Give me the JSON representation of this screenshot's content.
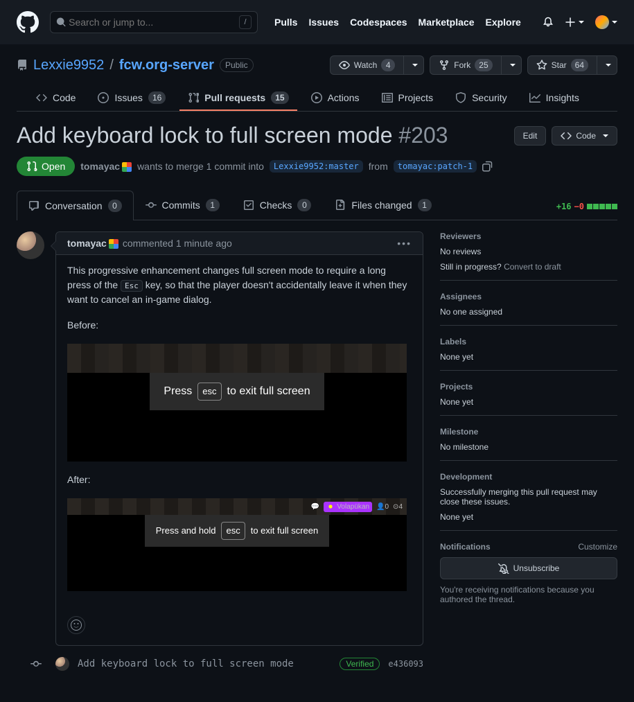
{
  "header": {
    "search_placeholder": "Search or jump to...",
    "slash": "/",
    "nav": {
      "pulls": "Pulls",
      "issues": "Issues",
      "codespaces": "Codespaces",
      "marketplace": "Marketplace",
      "explore": "Explore"
    }
  },
  "repo": {
    "owner": "Lexxie9952",
    "name": "fcw.org-server",
    "visibility": "Public",
    "watch_label": "Watch",
    "watch_count": "4",
    "fork_label": "Fork",
    "fork_count": "25",
    "star_label": "Star",
    "star_count": "64"
  },
  "repo_tabs": {
    "code": "Code",
    "issues": "Issues",
    "issues_count": "16",
    "pulls": "Pull requests",
    "pulls_count": "15",
    "actions": "Actions",
    "projects": "Projects",
    "security": "Security",
    "insights": "Insights"
  },
  "pr": {
    "title": "Add keyboard lock to full screen mode",
    "number": "#203",
    "edit": "Edit",
    "code_btn": "Code",
    "state": "Open",
    "author": "tomayac",
    "merge_line_a": "wants to merge 1 commit into",
    "base_branch": "Lexxie9952:master",
    "from": "from",
    "head_branch": "tomayac:patch-1"
  },
  "pr_tabs": {
    "conversation": "Conversation",
    "conversation_count": "0",
    "commits": "Commits",
    "commits_count": "1",
    "checks": "Checks",
    "checks_count": "0",
    "files": "Files changed",
    "files_count": "1",
    "additions": "+16",
    "deletions": "−0"
  },
  "comment": {
    "author": "tomayac",
    "when": "commented 1 minute ago",
    "body_text_a": "This progressive enhancement changes full screen mode to require a long press of the ",
    "esc": "Esc",
    "body_text_b": " key, so that the player doesn't accidentally leave it when they want to cancel an in-game dialog.",
    "before": "Before:",
    "after": "After:",
    "fs1_a": "Press",
    "fs1_key": "esc",
    "fs1_b": "to exit full screen",
    "fs2_a": "Press and hold",
    "fs2_key": "esc",
    "fs2_b": "to exit full screen",
    "volap": "Volapükan",
    "stat1": "0",
    "stat2": "4"
  },
  "commit": {
    "message": "Add keyboard lock to full screen mode",
    "verified": "Verified",
    "sha": "e436093"
  },
  "sidebar": {
    "reviewers_h": "Reviewers",
    "reviewers_v": "No reviews",
    "progress_q": "Still in progress?",
    "convert": "Convert to draft",
    "assignees_h": "Assignees",
    "assignees_v": "No one assigned",
    "labels_h": "Labels",
    "labels_v": "None yet",
    "projects_h": "Projects",
    "projects_v": "None yet",
    "milestone_h": "Milestone",
    "milestone_v": "No milestone",
    "development_h": "Development",
    "development_v": "Successfully merging this pull request may close these issues.",
    "development_none": "None yet",
    "notifications_h": "Notifications",
    "customize": "Customize",
    "unsubscribe": "Unsubscribe",
    "notify_reason": "You're receiving notifications because you authored the thread."
  }
}
